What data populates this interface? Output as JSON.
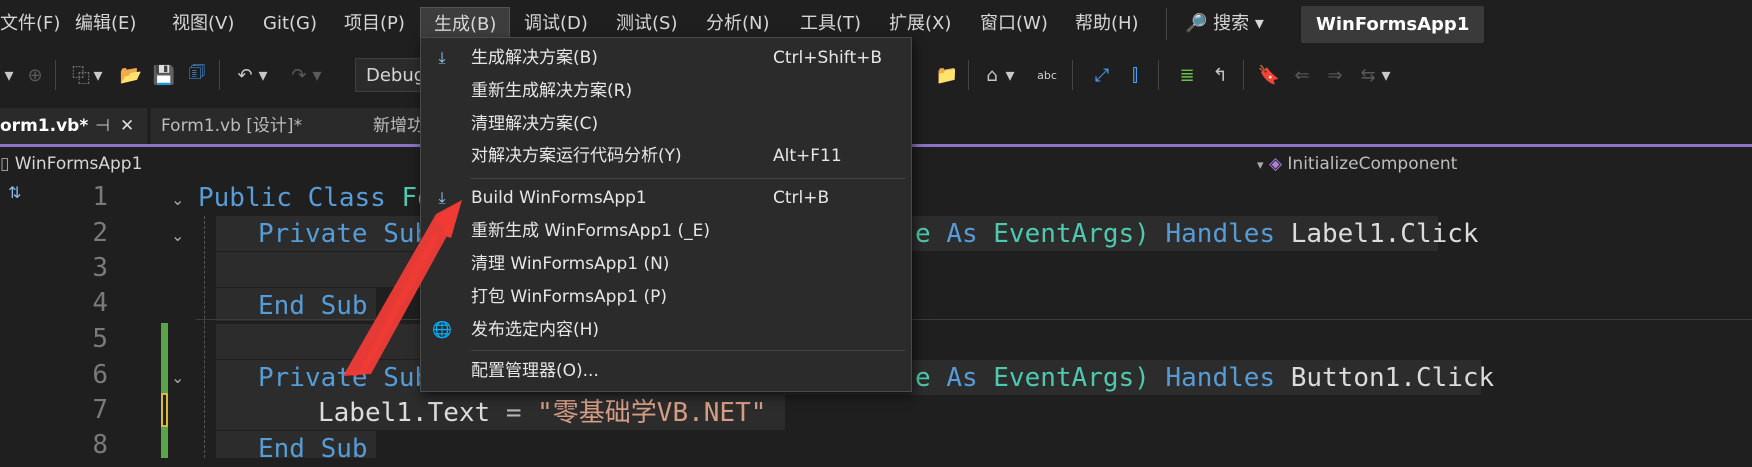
{
  "menubar": {
    "items": [
      {
        "label": "文件(F)"
      },
      {
        "label": "编辑(E)"
      },
      {
        "label": "视图(V)"
      },
      {
        "label": "Git(G)"
      },
      {
        "label": "项目(P)"
      },
      {
        "label": "生成(B)"
      },
      {
        "label": "调试(D)"
      },
      {
        "label": "测试(S)"
      },
      {
        "label": "分析(N)"
      },
      {
        "label": "工具(T)"
      },
      {
        "label": "扩展(X)"
      },
      {
        "label": "窗口(W)"
      },
      {
        "label": "帮助(H)"
      }
    ],
    "search_label": "🔎 搜索 ▾",
    "app_title": "WinFormsApp1"
  },
  "toolbar": {
    "configuration": "Debug"
  },
  "tabs": {
    "active": "orm1.vb*",
    "active_pin": "⊣",
    "active_close": "✕",
    "items": [
      {
        "label": "Form1.vb [设计]*"
      },
      {
        "label": "新增功"
      }
    ]
  },
  "navbar": {
    "project": "WinFormsApp1",
    "member": "InitializeComponent"
  },
  "editor": {
    "line_numbers": [
      "1",
      "2",
      "3",
      "4",
      "5",
      "6",
      "7",
      "8"
    ],
    "line1": {
      "kw": "Public Class",
      "ty": "Fo"
    },
    "line2": {
      "kw": "Private Sub",
      "tail_ty1": "e",
      "tail_kw1": "As",
      "tail_ty2": "EventArgs)",
      "tail_kw2": "Handles",
      "tail_id": "Label1.Click"
    },
    "line4": {
      "kw": "End Sub"
    },
    "line6": {
      "kw": "Private Sub",
      "tail_ty1": "e",
      "tail_kw1": "As",
      "tail_ty2": "EventArgs)",
      "tail_kw2": "Handles",
      "tail_id": "Button1.Click"
    },
    "line7": {
      "id": "Label1.Text",
      "op": "=",
      "str": "\"零基础学VB.NET\""
    },
    "line8": {
      "kw": "End Sub"
    }
  },
  "build_menu": {
    "items": [
      {
        "label": "生成解决方案(B)",
        "shortcut": "Ctrl+Shift+B"
      },
      {
        "label": "重新生成解决方案(R)",
        "shortcut": ""
      },
      {
        "label": "清理解决方案(C)",
        "shortcut": ""
      },
      {
        "label": "对解决方案运行代码分析(Y)",
        "shortcut": "Alt+F11"
      },
      {
        "label": "Build WinFormsApp1",
        "shortcut": "Ctrl+B"
      },
      {
        "label": "重新生成 WinFormsApp1 (_E)",
        "shortcut": ""
      },
      {
        "label": "清理 WinFormsApp1 (N)",
        "shortcut": ""
      },
      {
        "label": "打包 WinFormsApp1 (P)",
        "shortcut": ""
      },
      {
        "label": "发布选定内容(H)",
        "shortcut": ""
      },
      {
        "label": "配置管理器(O)...",
        "shortcut": ""
      }
    ]
  },
  "colors": {
    "accent": "#8a73c9",
    "keyword": "#569cd6",
    "type": "#4ec9b0",
    "string": "#d69d85",
    "arrow": "#ef3b36"
  },
  "icons": {
    "build": "build-solution-icon",
    "publish": "globe-icon"
  }
}
